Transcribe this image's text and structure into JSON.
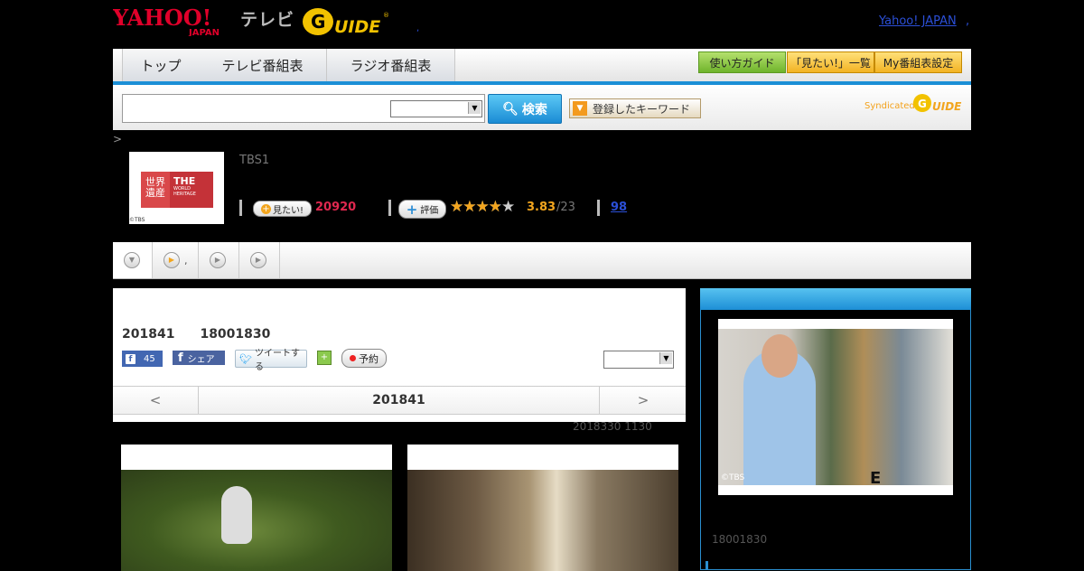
{
  "header": {
    "yahoo_logo": "YAHOO! JAPAN",
    "tv_label": "テレビ",
    "gguide_logo": "G-GUIDE",
    "dot": ",",
    "yahoo_japan_link": "Yahoo! JAPAN",
    "trailing_dot": ","
  },
  "nav": {
    "tabs": [
      "トップ",
      "テレビ番組表",
      "ラジオ番組表"
    ],
    "buttons": [
      "使い方ガイド",
      "「見たい!」一覧",
      "My番組表設定"
    ]
  },
  "search": {
    "button": "検索",
    "keyword_button": "登録したキーワード",
    "syndicated": "Syndicated"
  },
  "breadcrumb_gt": ">",
  "program": {
    "image_label_left": "世界遺産",
    "image_label_right": "THE",
    "image_label_right2": "WORLD",
    "image_label_right3": "HERITAGE",
    "image_credit": "©TBS",
    "channel": "TBS1",
    "mitai_button": "見たい!",
    "mitai_count": "20920",
    "hyoka_button": "評価",
    "rating": 3.83,
    "stars": "★★★★★",
    "rating_text": "3.83",
    "rating_denominator": "/23",
    "review_count": "98"
  },
  "tabs_strip": {
    "tab2_text": ","
  },
  "main": {
    "date_heading": "201841　　18001830",
    "fb_like_count": "45",
    "fb_share": "シェア",
    "tweet": "ツイートする",
    "yoyaku": "予約",
    "pager_prev": "<",
    "pager_current": "201841",
    "pager_next": ">",
    "updated": "2018330  1130"
  },
  "sidebar": {
    "photo_text": "E WORL",
    "photo_credit": "©TBS",
    "time": "18001830"
  },
  "colors": {
    "accent_blue": "#1b8fd6",
    "mitai_red": "#e0284f",
    "star_orange": "#f2a51e",
    "link_blue": "#2b4fd7"
  }
}
